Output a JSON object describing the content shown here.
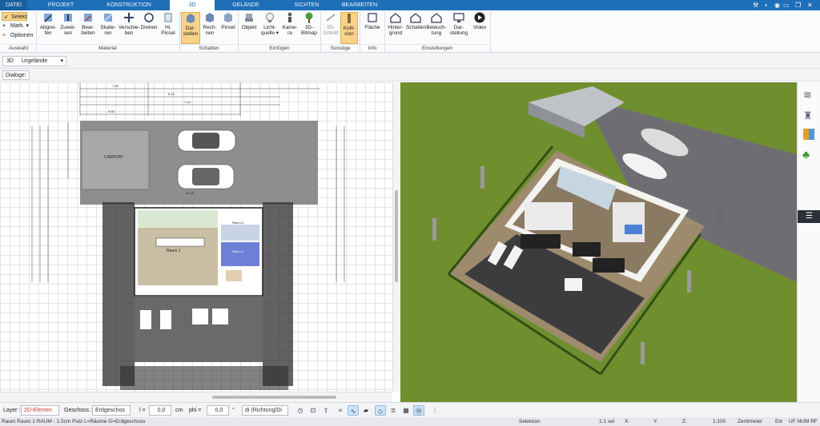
{
  "menu": {
    "tabs": [
      "DATEI",
      "PROJEKT",
      "KONSTRUKTION",
      "3D",
      "GELÄNDE",
      "SICHTEN",
      "BEARBEITEN"
    ],
    "active": "3D"
  },
  "ribbon": {
    "auswahl": {
      "items": [
        "Selekt",
        "Mark.",
        "Optionen"
      ],
      "group": "Auswahl"
    },
    "material": {
      "items": [
        [
          "Abgrei-",
          "fen"
        ],
        [
          "Zuwei-",
          "sen"
        ],
        [
          "Bear-",
          "beiten"
        ],
        [
          "Skalie-",
          "ren"
        ],
        [
          "Verschie-",
          "ben"
        ],
        [
          "Drehen",
          ""
        ],
        [
          "Hi.",
          "Pinsel"
        ]
      ],
      "group": "Material"
    },
    "schatten": {
      "items": [
        [
          "Dar-",
          "stellen"
        ],
        [
          "Rech-",
          "nen"
        ],
        [
          "Pinsel",
          ""
        ]
      ],
      "group": "Schatten"
    },
    "einfuegen": {
      "items": [
        [
          "Objekt",
          ""
        ],
        [
          "Licht-",
          "quelle"
        ],
        [
          "Kame-",
          "ra"
        ],
        [
          "3D-",
          "Bitmap"
        ]
      ],
      "group": "Einfügen"
    },
    "sonstige": {
      "items": [
        [
          "3D-",
          "Schnitt"
        ],
        [
          "Kolli-",
          "sion"
        ]
      ],
      "group": "Sonstige"
    },
    "info": {
      "items": [
        [
          "Fläche",
          ""
        ]
      ],
      "group": "Info"
    },
    "einstellungen": {
      "items": [
        [
          "Hinter-",
          "grund"
        ],
        [
          "Schatten",
          ""
        ],
        [
          "Beleuch-",
          "tung"
        ],
        [
          "Dar-",
          "stellung"
        ],
        [
          "Video",
          ""
        ]
      ],
      "group": "Einstellungen"
    }
  },
  "toolbar": {
    "mode": "3D",
    "terrain": "Urgelände",
    "dialoge": "Dialoge:"
  },
  "plan": {
    "carport": "CARPORT",
    "room1": "Raum 1",
    "room2": "Raum 2",
    "room3": "Raum 3",
    "dims": [
      "7.95",
      "3.65",
      "5.10",
      "4.44",
      "3.80",
      "8.16",
      "7.14",
      "1.05",
      "9.95",
      "1.17",
      "5.16",
      "10.16",
      "6.99",
      "3.00"
    ]
  },
  "bottom": {
    "layer_label": "Layer :",
    "layer_value": "2D-Elemen",
    "geschoss_label": "Geschoss :",
    "geschoss_value": "Erdgeschos",
    "l_label": "l =",
    "l_value": "0,0",
    "l_unit": "cm",
    "phi_label": "phi =",
    "phi_value": "0,0",
    "phi_unit": "°",
    "direction": "di (Richtung/Di"
  },
  "status": {
    "left": "Raum Raum 1 RAUM - 1.5cm Putz L=Räume G=Erdgeschoss",
    "mode": "Selektion",
    "sel": "1:1 sel",
    "x": "X:",
    "y": "Y:",
    "z": "Z:",
    "scale": "1:100",
    "unit": "Zentimeter",
    "ein": "Ein",
    "flags": "UF NUM RF"
  },
  "colors": {
    "accent": "#1e6fb8",
    "grass": "#6f8f2f",
    "highlight": "#f7d38a"
  }
}
